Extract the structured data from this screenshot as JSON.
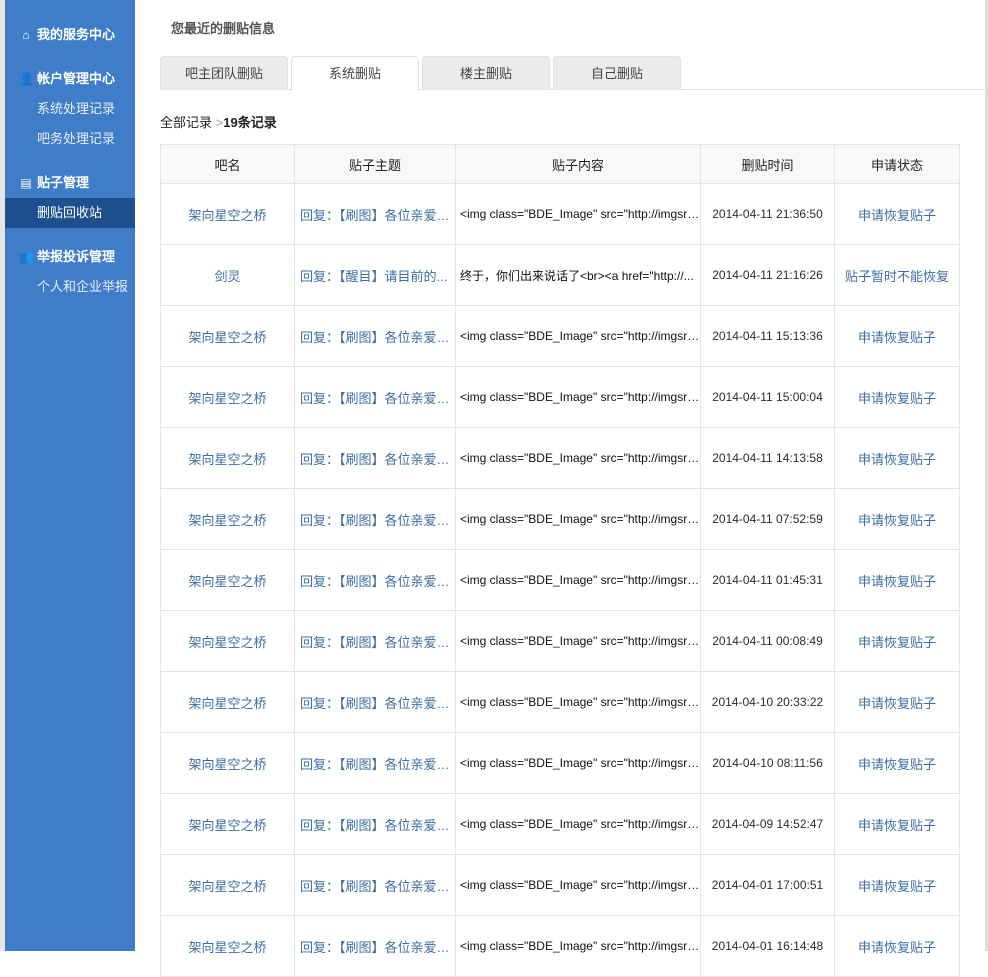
{
  "sidebar": {
    "sections": [
      {
        "label": "我的服务中心",
        "icon": "home-icon",
        "items": []
      },
      {
        "label": "帐户管理中心",
        "icon": "user-icon",
        "items": [
          "系统处理记录",
          "吧务处理记录"
        ]
      },
      {
        "label": "贴子管理",
        "icon": "document-icon",
        "items": [
          "删贴回收站"
        ]
      },
      {
        "label": "举报投诉管理",
        "icon": "users-icon",
        "items": [
          "个人和企业举报"
        ]
      }
    ],
    "active": "删贴回收站"
  },
  "header": {
    "title": "您最近的删贴信息"
  },
  "tabs": [
    {
      "label": "吧主团队删贴"
    },
    {
      "label": "系统删贴",
      "active": true
    },
    {
      "label": "楼主删贴"
    },
    {
      "label": "自己删贴"
    }
  ],
  "breadcrumb": {
    "root": "全部记录",
    "sep": ">",
    "count": "19条记录"
  },
  "table": {
    "columns": [
      "吧名",
      "贴子主题",
      "贴子内容",
      "删贴时间",
      "申请状态"
    ],
    "rows": [
      [
        "架向星空之桥",
        "回复：【刷图】各位亲爱的...",
        "<img class=\"BDE_Image\" src=\"http://imgsrc...",
        "2014-04-11 21:36:50",
        "申请恢复贴子"
      ],
      [
        "剑灵",
        "回复：【醒目】请目前的...",
        "终于，你们出来说话了<br><a href=\"http://...",
        "2014-04-11 21:16:26",
        "贴子暂时不能恢复"
      ],
      [
        "架向星空之桥",
        "回复：【刷图】各位亲爱的...",
        "<img class=\"BDE_Image\" src=\"http://imgsrc...",
        "2014-04-11 15:13:36",
        "申请恢复贴子"
      ],
      [
        "架向星空之桥",
        "回复：【刷图】各位亲爱的...",
        "<img class=\"BDE_Image\" src=\"http://imgsrc...",
        "2014-04-11 15:00:04",
        "申请恢复贴子"
      ],
      [
        "架向星空之桥",
        "回复：【刷图】各位亲爱的...",
        "<img class=\"BDE_Image\" src=\"http://imgsrc...",
        "2014-04-11 14:13:58",
        "申请恢复贴子"
      ],
      [
        "架向星空之桥",
        "回复：【刷图】各位亲爱的...",
        "<img class=\"BDE_Image\" src=\"http://imgsrc...",
        "2014-04-11 07:52:59",
        "申请恢复贴子"
      ],
      [
        "架向星空之桥",
        "回复：【刷图】各位亲爱的...",
        "<img class=\"BDE_Image\" src=\"http://imgsrc...",
        "2014-04-11 01:45:31",
        "申请恢复贴子"
      ],
      [
        "架向星空之桥",
        "回复：【刷图】各位亲爱的...",
        "<img class=\"BDE_Image\" src=\"http://imgsrc...",
        "2014-04-11 00:08:49",
        "申请恢复贴子"
      ],
      [
        "架向星空之桥",
        "回复：【刷图】各位亲爱的...",
        "<img class=\"BDE_Image\" src=\"http://imgsrc...",
        "2014-04-10 20:33:22",
        "申请恢复贴子"
      ],
      [
        "架向星空之桥",
        "回复：【刷图】各位亲爱的...",
        "<img class=\"BDE_Image\" src=\"http://imgsrc...",
        "2014-04-10 08:11:56",
        "申请恢复贴子"
      ],
      [
        "架向星空之桥",
        "回复：【刷图】各位亲爱的...",
        "<img class=\"BDE_Image\" src=\"http://imgsrc...",
        "2014-04-09 14:52:47",
        "申请恢复贴子"
      ],
      [
        "架向星空之桥",
        "回复：【刷图】各位亲爱的...",
        "<img class=\"BDE_Image\" src=\"http://imgsrc...",
        "2014-04-01 17:00:51",
        "申请恢复贴子"
      ],
      [
        "架向星空之桥",
        "回复：【刷图】各位亲爱的...",
        "<img class=\"BDE_Image\" src=\"http://imgsrc...",
        "2014-04-01 16:14:48",
        "申请恢复贴子"
      ]
    ]
  },
  "colors": {
    "sidebar": "#3f7dc8",
    "sidebar_active": "#1e4f8e",
    "link": "#3d6ea3"
  }
}
